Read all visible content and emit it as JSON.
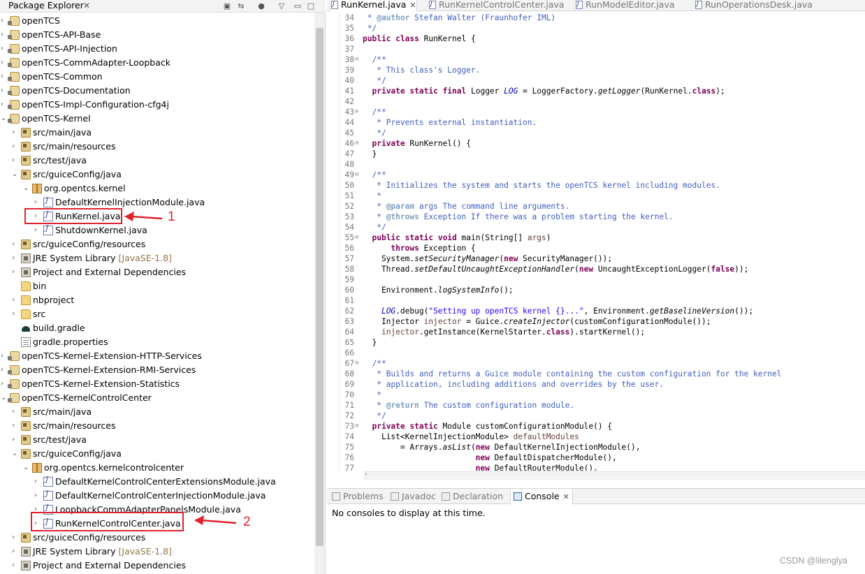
{
  "package_explorer": {
    "title": "Package Explorer",
    "tree": [
      {
        "label": "openTCS",
        "depth": 0,
        "icon": "project-icon",
        "expanded": false
      },
      {
        "label": "openTCS-API-Base",
        "depth": 0,
        "icon": "project-icon",
        "expanded": false
      },
      {
        "label": "openTCS-API-Injection",
        "depth": 0,
        "icon": "project-icon",
        "expanded": false
      },
      {
        "label": "openTCS-CommAdapter-Loopback",
        "depth": 0,
        "icon": "project-icon",
        "expanded": false
      },
      {
        "label": "openTCS-Common",
        "depth": 0,
        "icon": "project-icon",
        "expanded": false
      },
      {
        "label": "openTCS-Documentation",
        "depth": 0,
        "icon": "project-icon",
        "expanded": false
      },
      {
        "label": "openTCS-Impl-Configuration-cfg4j",
        "depth": 0,
        "icon": "project-icon",
        "expanded": false
      },
      {
        "label": "openTCS-Kernel",
        "depth": 0,
        "icon": "project-icon",
        "expanded": true
      },
      {
        "label": "src/main/java",
        "depth": 1,
        "icon": "source-folder-icon",
        "expanded": false
      },
      {
        "label": "src/main/resources",
        "depth": 1,
        "icon": "source-folder-icon",
        "expanded": false
      },
      {
        "label": "src/test/java",
        "depth": 1,
        "icon": "source-folder-icon",
        "expanded": false
      },
      {
        "label": "src/guiceConfig/java",
        "depth": 1,
        "icon": "source-folder-icon",
        "expanded": true
      },
      {
        "label": "org.opentcs.kernel",
        "depth": 2,
        "icon": "package-icon",
        "expanded": true
      },
      {
        "label": "DefaultKernelInjectionModule.java",
        "depth": 3,
        "icon": "java-file-icon",
        "expanded": false
      },
      {
        "label": "RunKernel.java",
        "depth": 3,
        "icon": "java-file-icon",
        "expanded": false
      },
      {
        "label": "ShutdownKernel.java",
        "depth": 3,
        "icon": "java-file-icon",
        "expanded": false
      },
      {
        "label": "src/guiceConfig/resources",
        "depth": 1,
        "icon": "source-folder-icon",
        "expanded": false
      },
      {
        "label": "JRE System Library",
        "suffix": "[JavaSE-1.8]",
        "depth": 1,
        "icon": "library-icon",
        "expanded": false
      },
      {
        "label": "Project and External Dependencies",
        "depth": 1,
        "icon": "library-icon",
        "expanded": false
      },
      {
        "label": "bin",
        "depth": 1,
        "icon": "folder-icon",
        "expanded": null
      },
      {
        "label": "nbproject",
        "depth": 1,
        "icon": "folder-icon",
        "expanded": false
      },
      {
        "label": "src",
        "depth": 1,
        "icon": "folder-icon",
        "expanded": false
      },
      {
        "label": "build.gradle",
        "depth": 1,
        "icon": "gradle-icon",
        "expanded": null
      },
      {
        "label": "gradle.properties",
        "depth": 1,
        "icon": "file-icon",
        "expanded": null
      },
      {
        "label": "openTCS-Kernel-Extension-HTTP-Services",
        "depth": 0,
        "icon": "project-icon",
        "expanded": false
      },
      {
        "label": "openTCS-Kernel-Extension-RMI-Services",
        "depth": 0,
        "icon": "project-icon",
        "expanded": false
      },
      {
        "label": "openTCS-Kernel-Extension-Statistics",
        "depth": 0,
        "icon": "project-icon",
        "expanded": false
      },
      {
        "label": "openTCS-KernelControlCenter",
        "depth": 0,
        "icon": "project-icon",
        "expanded": true
      },
      {
        "label": "src/main/java",
        "depth": 1,
        "icon": "source-folder-icon",
        "expanded": false
      },
      {
        "label": "src/main/resources",
        "depth": 1,
        "icon": "source-folder-icon",
        "expanded": false
      },
      {
        "label": "src/test/java",
        "depth": 1,
        "icon": "source-folder-icon",
        "expanded": false
      },
      {
        "label": "src/guiceConfig/java",
        "depth": 1,
        "icon": "source-folder-icon",
        "expanded": true
      },
      {
        "label": "org.opentcs.kernelcontrolcenter",
        "depth": 2,
        "icon": "package-icon",
        "expanded": true
      },
      {
        "label": "DefaultKernelControlCenterExtensionsModule.java",
        "depth": 3,
        "icon": "java-file-icon",
        "expanded": false
      },
      {
        "label": "DefaultKernelControlCenterInjectionModule.java",
        "depth": 3,
        "icon": "java-file-icon",
        "expanded": false
      },
      {
        "label": "LoopbackCommAdapterPanelsModule.java",
        "depth": 3,
        "icon": "java-file-icon",
        "expanded": false
      },
      {
        "label": "RunKernelControlCenter.java",
        "depth": 3,
        "icon": "java-file-icon",
        "expanded": false
      },
      {
        "label": "src/guiceConfig/resources",
        "depth": 1,
        "icon": "source-folder-icon",
        "expanded": false
      },
      {
        "label": "JRE System Library",
        "suffix": "[JavaSE-1.8]",
        "depth": 1,
        "icon": "library-icon",
        "expanded": false
      },
      {
        "label": "Project and External Dependencies",
        "depth": 1,
        "icon": "library-icon",
        "expanded": false
      }
    ]
  },
  "annotations": [
    {
      "label": "1",
      "target": "RunKernel.java"
    },
    {
      "label": "2",
      "target": "RunKernelControlCenter.java"
    }
  ],
  "editor": {
    "tabs": [
      {
        "label": "RunKernel.java",
        "active": true
      },
      {
        "label": "RunKernelControlCenter.java",
        "active": false
      },
      {
        "label": "RunModelEditor.java",
        "active": false
      },
      {
        "label": "RunOperationsDesk.java",
        "active": false
      }
    ],
    "lines": [
      {
        "n": "34",
        "fold": "",
        "code": " * @author Stefan Walter (Fraunhofer IML)",
        "style": "comment"
      },
      {
        "n": "35",
        "fold": "",
        "code": " */",
        "style": "comment"
      },
      {
        "n": "36",
        "fold": "",
        "code": "public class RunKernel {",
        "style": "code"
      },
      {
        "n": "37",
        "fold": "",
        "code": "",
        "style": "code"
      },
      {
        "n": "38",
        "fold": "⊖",
        "code": "  /**",
        "style": "comment"
      },
      {
        "n": "39",
        "fold": "",
        "code": "   * This class's Logger.",
        "style": "comment"
      },
      {
        "n": "40",
        "fold": "",
        "code": "   */",
        "style": "comment"
      },
      {
        "n": "41",
        "fold": "",
        "code": "  private static final Logger LOG = LoggerFactory.getLogger(RunKernel.class);",
        "style": "code"
      },
      {
        "n": "42",
        "fold": "",
        "code": "",
        "style": "code"
      },
      {
        "n": "43",
        "fold": "⊖",
        "code": "  /**",
        "style": "comment"
      },
      {
        "n": "44",
        "fold": "",
        "code": "   * Prevents external instantiation.",
        "style": "comment"
      },
      {
        "n": "45",
        "fold": "",
        "code": "   */",
        "style": "comment"
      },
      {
        "n": "46",
        "fold": "⊖",
        "code": "  private RunKernel() {",
        "style": "code"
      },
      {
        "n": "47",
        "fold": "",
        "code": "  }",
        "style": "code"
      },
      {
        "n": "48",
        "fold": "",
        "code": "",
        "style": "code"
      },
      {
        "n": "49",
        "fold": "⊖",
        "code": "  /**",
        "style": "comment"
      },
      {
        "n": "50",
        "fold": "",
        "code": "   * Initializes the system and starts the openTCS kernel including modules.",
        "style": "comment"
      },
      {
        "n": "51",
        "fold": "",
        "code": "   *",
        "style": "comment"
      },
      {
        "n": "52",
        "fold": "",
        "code": "   * @param args The command line arguments.",
        "style": "comment"
      },
      {
        "n": "53",
        "fold": "",
        "code": "   * @throws Exception If there was a problem starting the kernel.",
        "style": "comment"
      },
      {
        "n": "54",
        "fold": "",
        "code": "   */",
        "style": "comment"
      },
      {
        "n": "55",
        "fold": "⊖",
        "code": "  public static void main(String[] args)",
        "style": "code"
      },
      {
        "n": "56",
        "fold": "",
        "code": "      throws Exception {",
        "style": "code"
      },
      {
        "n": "57",
        "fold": "",
        "code": "    System.setSecurityManager(new SecurityManager());",
        "style": "code"
      },
      {
        "n": "58",
        "fold": "",
        "code": "    Thread.setDefaultUncaughtExceptionHandler(new UncaughtExceptionLogger(false));",
        "style": "code"
      },
      {
        "n": "59",
        "fold": "",
        "code": "",
        "style": "code"
      },
      {
        "n": "60",
        "fold": "",
        "code": "    Environment.logSystemInfo();",
        "style": "code"
      },
      {
        "n": "61",
        "fold": "",
        "code": "",
        "style": "code"
      },
      {
        "n": "62",
        "fold": "",
        "code": "    LOG.debug(\"Setting up openTCS kernel {}...\", Environment.getBaselineVersion());",
        "style": "code"
      },
      {
        "n": "63",
        "fold": "",
        "code": "    Injector injector = Guice.createInjector(customConfigurationModule());",
        "style": "code"
      },
      {
        "n": "64",
        "fold": "",
        "code": "    injector.getInstance(KernelStarter.class).startKernel();",
        "style": "code"
      },
      {
        "n": "65",
        "fold": "",
        "code": "  }",
        "style": "code"
      },
      {
        "n": "66",
        "fold": "",
        "code": "",
        "style": "code"
      },
      {
        "n": "67",
        "fold": "⊖",
        "code": "  /**",
        "style": "comment"
      },
      {
        "n": "68",
        "fold": "",
        "code": "   * Builds and returns a Guice module containing the custom configuration for the kernel",
        "style": "comment"
      },
      {
        "n": "69",
        "fold": "",
        "code": "   * application, including additions and overrides by the user.",
        "style": "comment"
      },
      {
        "n": "70",
        "fold": "",
        "code": "   *",
        "style": "comment"
      },
      {
        "n": "71",
        "fold": "",
        "code": "   * @return The custom configuration module.",
        "style": "comment"
      },
      {
        "n": "72",
        "fold": "",
        "code": "   */",
        "style": "comment"
      },
      {
        "n": "73",
        "fold": "⊖",
        "code": "  private static Module customConfigurationModule() {",
        "style": "code"
      },
      {
        "n": "74",
        "fold": "",
        "code": "    List<KernelInjectionModule> defaultModules",
        "style": "code"
      },
      {
        "n": "75",
        "fold": "",
        "code": "        = Arrays.asList(new DefaultKernelInjectionModule(),",
        "style": "code"
      },
      {
        "n": "76",
        "fold": "",
        "code": "                        new DefaultDispatcherModule(),",
        "style": "code"
      },
      {
        "n": "77",
        "fold": "",
        "code": "                        new DefaultRouterModule(),",
        "style": "code"
      }
    ]
  },
  "bottom_panel": {
    "tabs": [
      {
        "label": "Problems",
        "active": false
      },
      {
        "label": "Javadoc",
        "active": false
      },
      {
        "label": "Declaration",
        "active": false
      },
      {
        "label": "Console",
        "active": true
      }
    ],
    "message": "No consoles to display at this time."
  },
  "watermark": "CSDN @lilenglya",
  "colors": {
    "annotation": "#e0222b",
    "keyword": "#7f0055",
    "comment": "#3f5fbf",
    "string": "#2a00ff"
  }
}
